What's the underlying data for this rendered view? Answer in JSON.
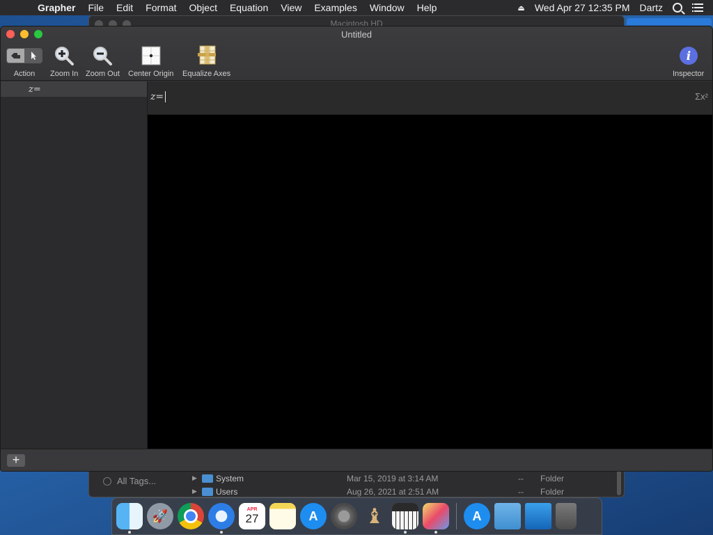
{
  "menubar": {
    "apple_glyph": "",
    "items": [
      "Grapher",
      "File",
      "Edit",
      "Format",
      "Object",
      "Equation",
      "View",
      "Examples",
      "Window",
      "Help"
    ],
    "datetime": "Wed Apr 27  12:35 PM",
    "user": "Dartz"
  },
  "background_window": {
    "title": "Macintosh HD",
    "sidebar_tags": "All Tags...",
    "files": [
      {
        "name": "System",
        "date": "Mar 15, 2019 at 3:14 AM",
        "size": "--",
        "kind": "Folder"
      },
      {
        "name": "Users",
        "date": "Aug 26, 2021 at 2:51 AM",
        "size": "--",
        "kind": "Folder"
      }
    ]
  },
  "window": {
    "title": "Untitled",
    "toolbar": {
      "action": "Action",
      "zoom_in": "Zoom In",
      "zoom_out": "Zoom Out",
      "center_origin": "Center Origin",
      "equalize_axes": "Equalize Axes",
      "inspector": "Inspector"
    },
    "equation_list": [
      {
        "label": "z="
      }
    ],
    "equation_input": "z=",
    "sigma_label": "Σx²",
    "add_button": "+"
  },
  "dock": {
    "calendar_month": "APR",
    "calendar_day": "27",
    "appstore_glyph": "A"
  },
  "colors": {
    "close": "#fe5f57",
    "minimize": "#febc2e",
    "maximize": "#28c840",
    "inspector_blue": "#5b6fe0",
    "graph_background": "#000000"
  }
}
